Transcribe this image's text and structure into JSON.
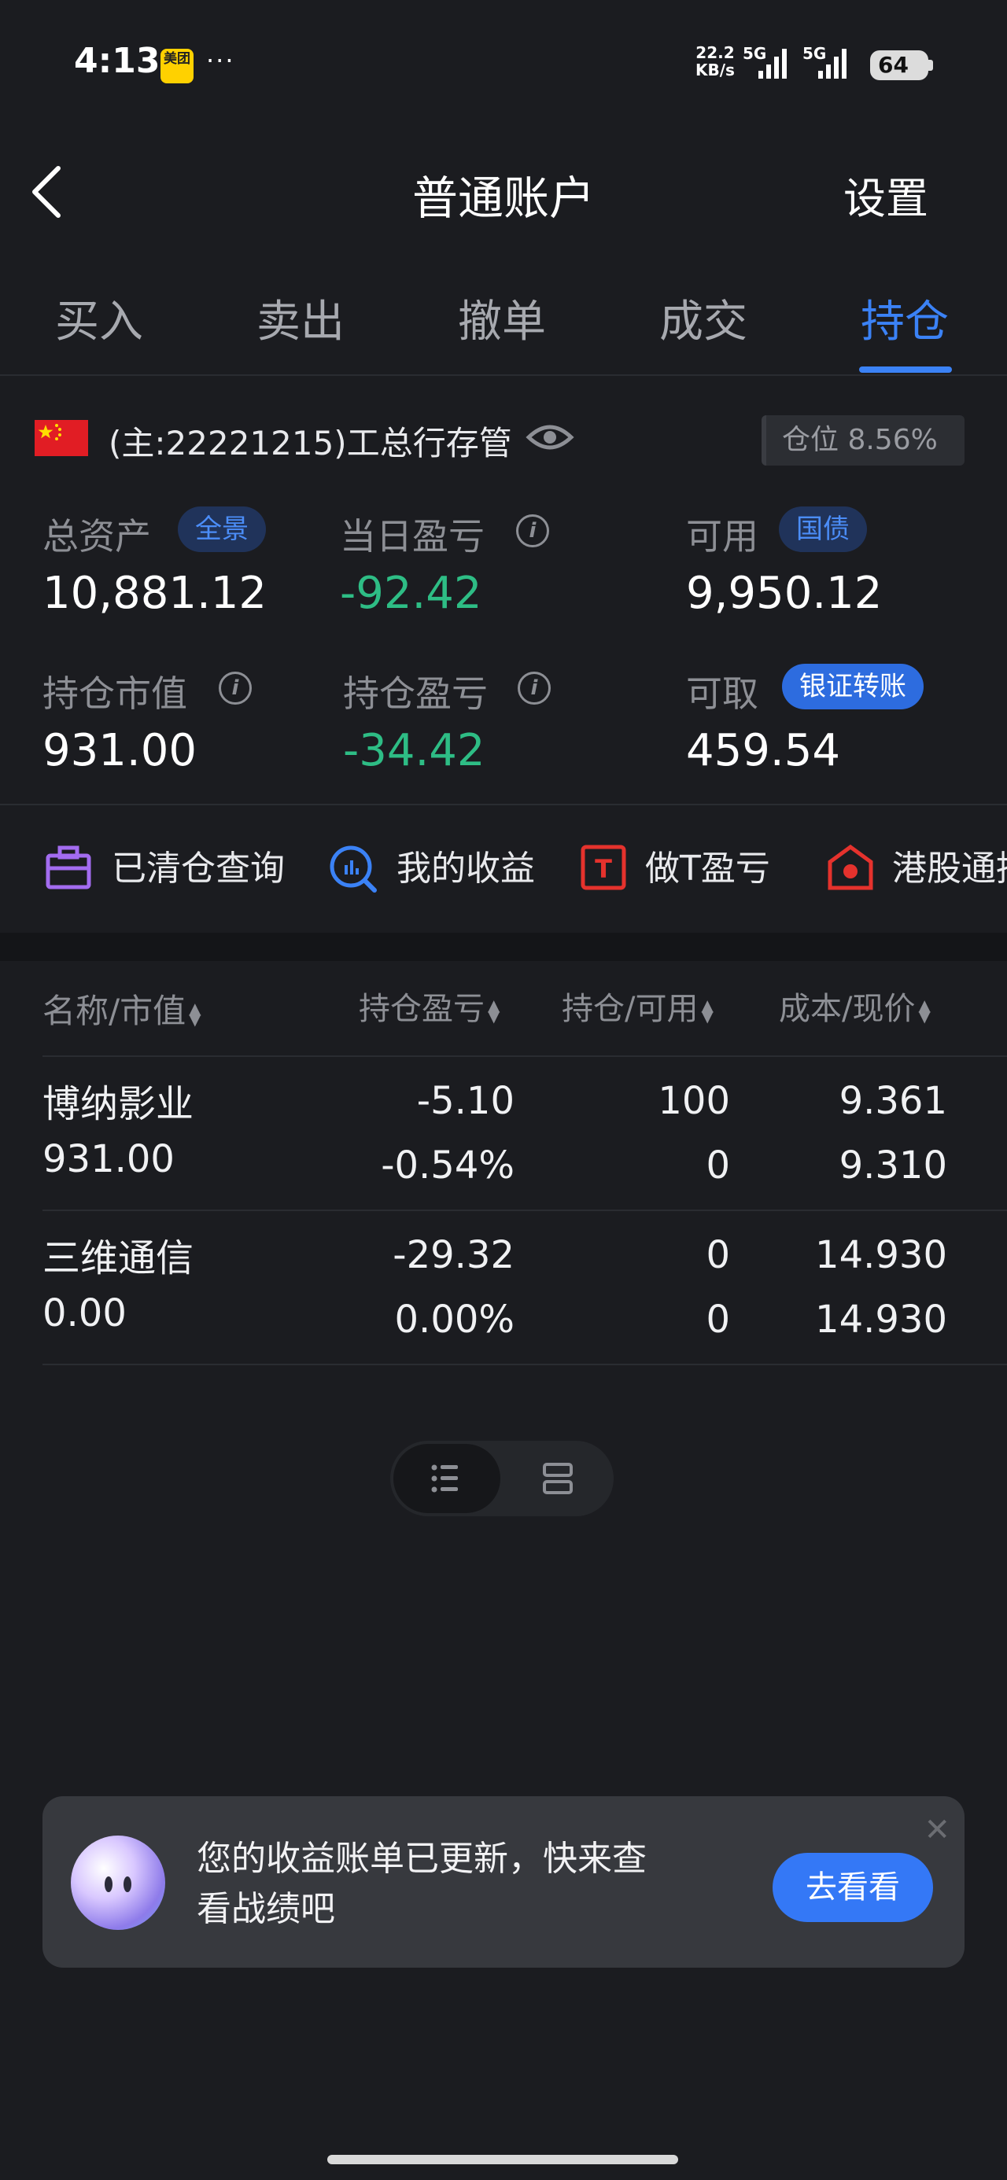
{
  "status_bar": {
    "time": "4:13",
    "app_icon_label": "美团",
    "dots": "···",
    "net_speed_value": "22.2",
    "net_speed_unit": "KB/s",
    "sig1_label": "5G",
    "sig2_label": "5G",
    "battery": "64"
  },
  "header": {
    "title": "普通账户",
    "settings": "设置"
  },
  "tabs": [
    {
      "label": "买入"
    },
    {
      "label": "卖出"
    },
    {
      "label": "撤单"
    },
    {
      "label": "成交"
    },
    {
      "label": "持仓",
      "active": true
    }
  ],
  "account": {
    "name": "(主:22221215)工总行存管",
    "position_ratio": "仓位 8.56%"
  },
  "metrics": {
    "total_assets": {
      "label": "总资产",
      "badge": "全景",
      "value": "10,881.12"
    },
    "daily_pnl": {
      "label": "当日盈亏",
      "value": "-92.42"
    },
    "available": {
      "label": "可用",
      "badge": "国债",
      "value": "9,950.12"
    },
    "position_value": {
      "label": "持仓市值",
      "value": "931.00"
    },
    "position_pnl": {
      "label": "持仓盈亏",
      "value": "-34.42"
    },
    "withdrawable": {
      "label": "可取",
      "badge": "银证转账",
      "value": "459.54"
    }
  },
  "quick_actions": [
    {
      "label": "已清仓查询"
    },
    {
      "label": "我的收益"
    },
    {
      "label": "做T盈亏"
    },
    {
      "label": "港股通持"
    }
  ],
  "table": {
    "headers": [
      "名称/市值",
      "持仓盈亏",
      "持仓/可用",
      "成本/现价"
    ],
    "rows": [
      {
        "name": "博纳影业",
        "market_value": "931.00",
        "pnl": "-5.10",
        "pnl_pct": "-0.54%",
        "hold": "100",
        "avail": "0",
        "cost": "9.361",
        "price": "9.310"
      },
      {
        "name": "三维通信",
        "market_value": "0.00",
        "pnl": "-29.32",
        "pnl_pct": "0.00%",
        "hold": "0",
        "avail": "0",
        "cost": "14.930",
        "price": "14.930"
      }
    ]
  },
  "promo": {
    "text": "您的收益账单已更新，快来查看战绩吧",
    "button": "去看看"
  },
  "colors": {
    "background": "#1b1c20",
    "accent": "#3b82f6",
    "loss_green": "#2ebd85"
  }
}
